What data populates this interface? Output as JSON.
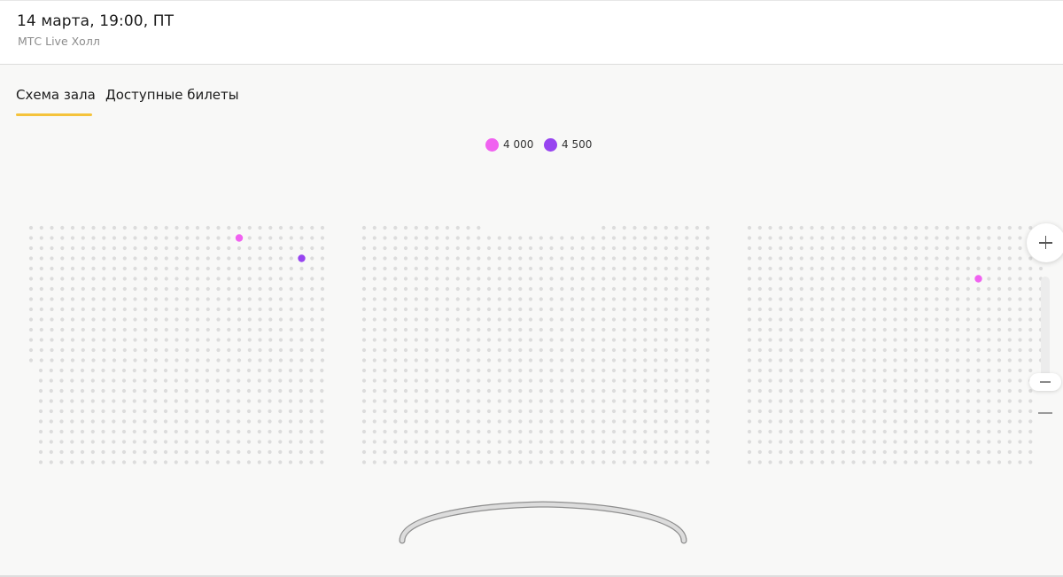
{
  "event": {
    "title": "14 марта, 19:00, ПТ",
    "venue": "МТС Live Холл"
  },
  "tabs": [
    {
      "label": "Схема зала",
      "active": true
    },
    {
      "label": "Доступные билеты",
      "active": false
    }
  ],
  "legend": [
    {
      "price": "4 000",
      "color": "#f062f0"
    },
    {
      "price": "4 500",
      "color": "#9744f0"
    }
  ],
  "seat_colors": {
    "unavailable": "#dcdcdc",
    "price_4000": "#f062f0",
    "price_4500": "#9744f0"
  },
  "available_seats": [
    {
      "sector": "left",
      "row": 2,
      "seat": 21,
      "price": "4 000"
    },
    {
      "sector": "left",
      "row": 4,
      "seat": 27,
      "price": "4 500"
    },
    {
      "sector": "right",
      "row": 6,
      "seat": 23,
      "price": "4 000"
    }
  ],
  "zoom": {
    "in_icon": "plus-icon",
    "out_icon": "minus-icon"
  }
}
